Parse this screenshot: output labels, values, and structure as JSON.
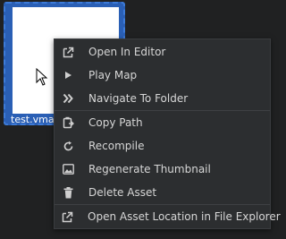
{
  "asset": {
    "filename": "test.vmap"
  },
  "context_menu": {
    "items": [
      {
        "label": "Open In Editor",
        "icon": "open-external-icon"
      },
      {
        "label": "Play Map",
        "icon": "play-icon"
      },
      {
        "label": "Navigate To Folder",
        "icon": "double-chevron-right-icon"
      },
      {
        "label": "Copy Path",
        "icon": "copy-path-icon"
      },
      {
        "label": "Recompile",
        "icon": "refresh-icon"
      },
      {
        "label": "Regenerate Thumbnail",
        "icon": "image-icon"
      },
      {
        "label": "Delete Asset",
        "icon": "trash-icon"
      },
      {
        "label": "Open Asset Location in File Explorer",
        "icon": "open-external-icon"
      }
    ]
  },
  "colors": {
    "selection": "#3d7bd8",
    "menu_bg": "#2c2e30",
    "background": "#202122"
  }
}
